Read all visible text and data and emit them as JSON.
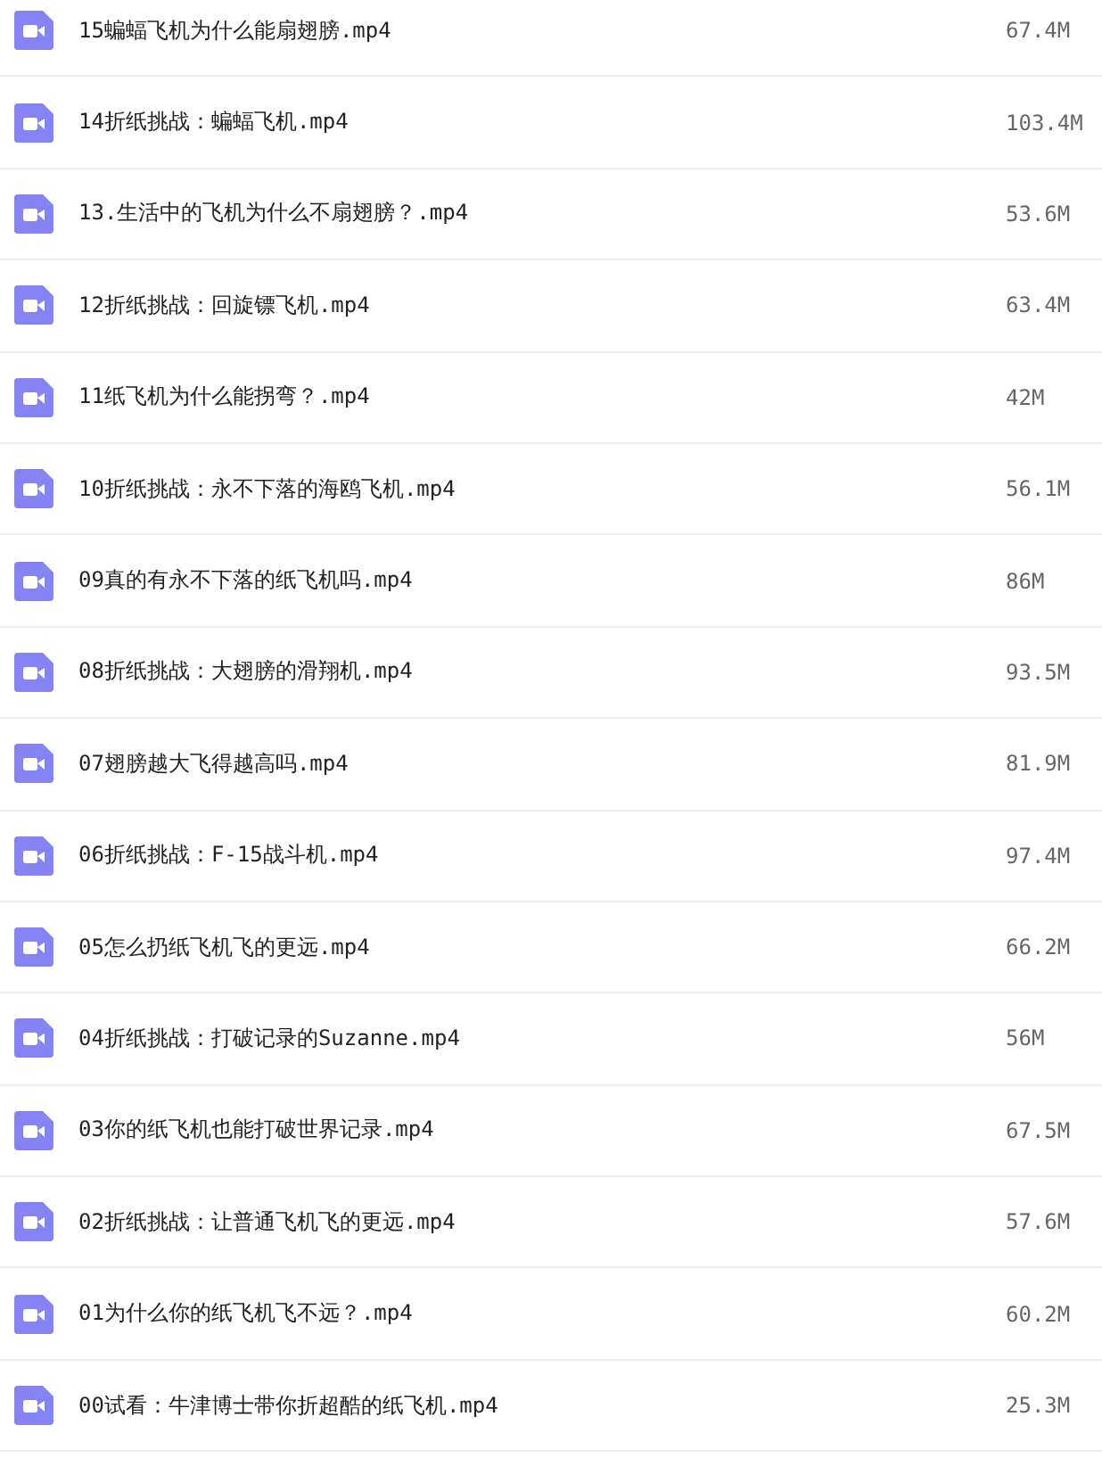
{
  "files": [
    {
      "name": "15蝙蝠飞机为什么能扇翅膀.mp4",
      "size": "67.4M"
    },
    {
      "name": "14折纸挑战：蝙蝠飞机.mp4",
      "size": "103.4M"
    },
    {
      "name": "13.生活中的飞机为什么不扇翅膀？.mp4",
      "size": "53.6M"
    },
    {
      "name": "12折纸挑战：回旋镖飞机.mp4",
      "size": "63.4M"
    },
    {
      "name": "11纸飞机为什么能拐弯？.mp4",
      "size": "42M"
    },
    {
      "name": "10折纸挑战：永不下落的海鸥飞机.mp4",
      "size": "56.1M"
    },
    {
      "name": "09真的有永不下落的纸飞机吗.mp4",
      "size": "86M"
    },
    {
      "name": "08折纸挑战：大翅膀的滑翔机.mp4",
      "size": "93.5M"
    },
    {
      "name": "07翅膀越大飞得越高吗.mp4",
      "size": "81.9M"
    },
    {
      "name": "06折纸挑战：F-15战斗机.mp4",
      "size": "97.4M"
    },
    {
      "name": "05怎么扔纸飞机飞的更远.mp4",
      "size": "66.2M"
    },
    {
      "name": "04折纸挑战：打破记录的Suzanne.mp4",
      "size": "56M"
    },
    {
      "name": "03你的纸飞机也能打破世界记录.mp4",
      "size": "67.5M"
    },
    {
      "name": "02折纸挑战：让普通飞机飞的更远.mp4",
      "size": "57.6M"
    },
    {
      "name": "01为什么你的纸飞机飞不远？.mp4",
      "size": "60.2M"
    },
    {
      "name": "00试看：牛津博士带你折超酷的纸飞机.mp4",
      "size": "25.3M"
    }
  ]
}
